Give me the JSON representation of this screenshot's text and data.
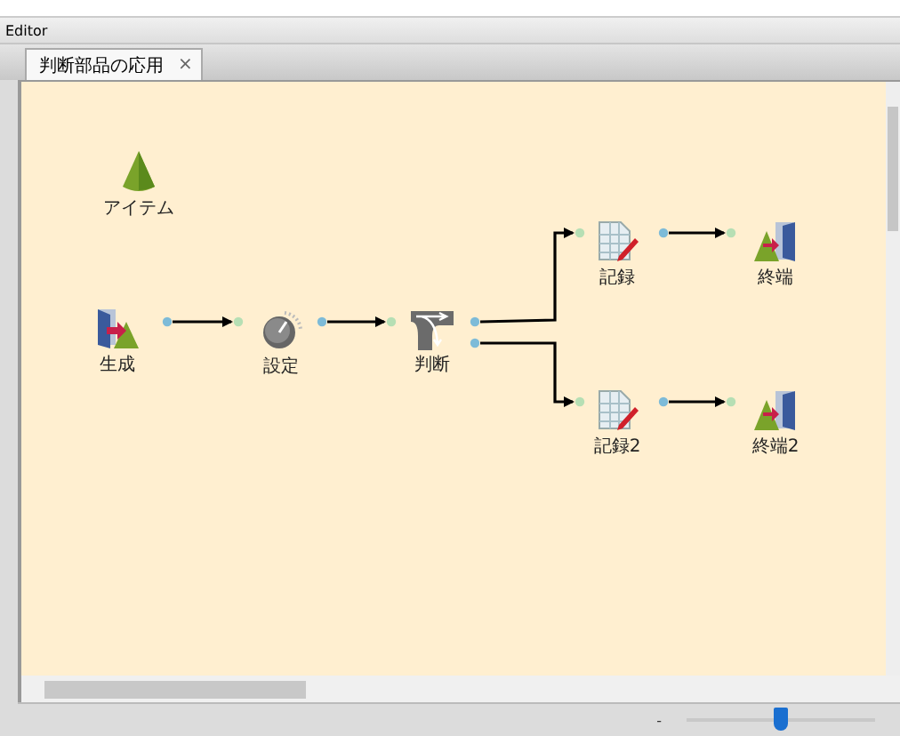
{
  "window": {
    "title": "Editor"
  },
  "tabs": [
    {
      "label": "判断部品の応用",
      "close": "×",
      "selected": true
    }
  ],
  "nodes": [
    {
      "label": "アイテム",
      "kind": "item"
    },
    {
      "label": "生成",
      "kind": "generate"
    },
    {
      "label": "設定",
      "kind": "setting"
    },
    {
      "label": "判断",
      "kind": "decision"
    },
    {
      "label": "記録",
      "kind": "record"
    },
    {
      "label": "終端",
      "kind": "end"
    },
    {
      "label": "記録2",
      "kind": "record"
    },
    {
      "label": "終端2",
      "kind": "end"
    }
  ],
  "zoom": {
    "minus": "-",
    "level": 0.5
  }
}
